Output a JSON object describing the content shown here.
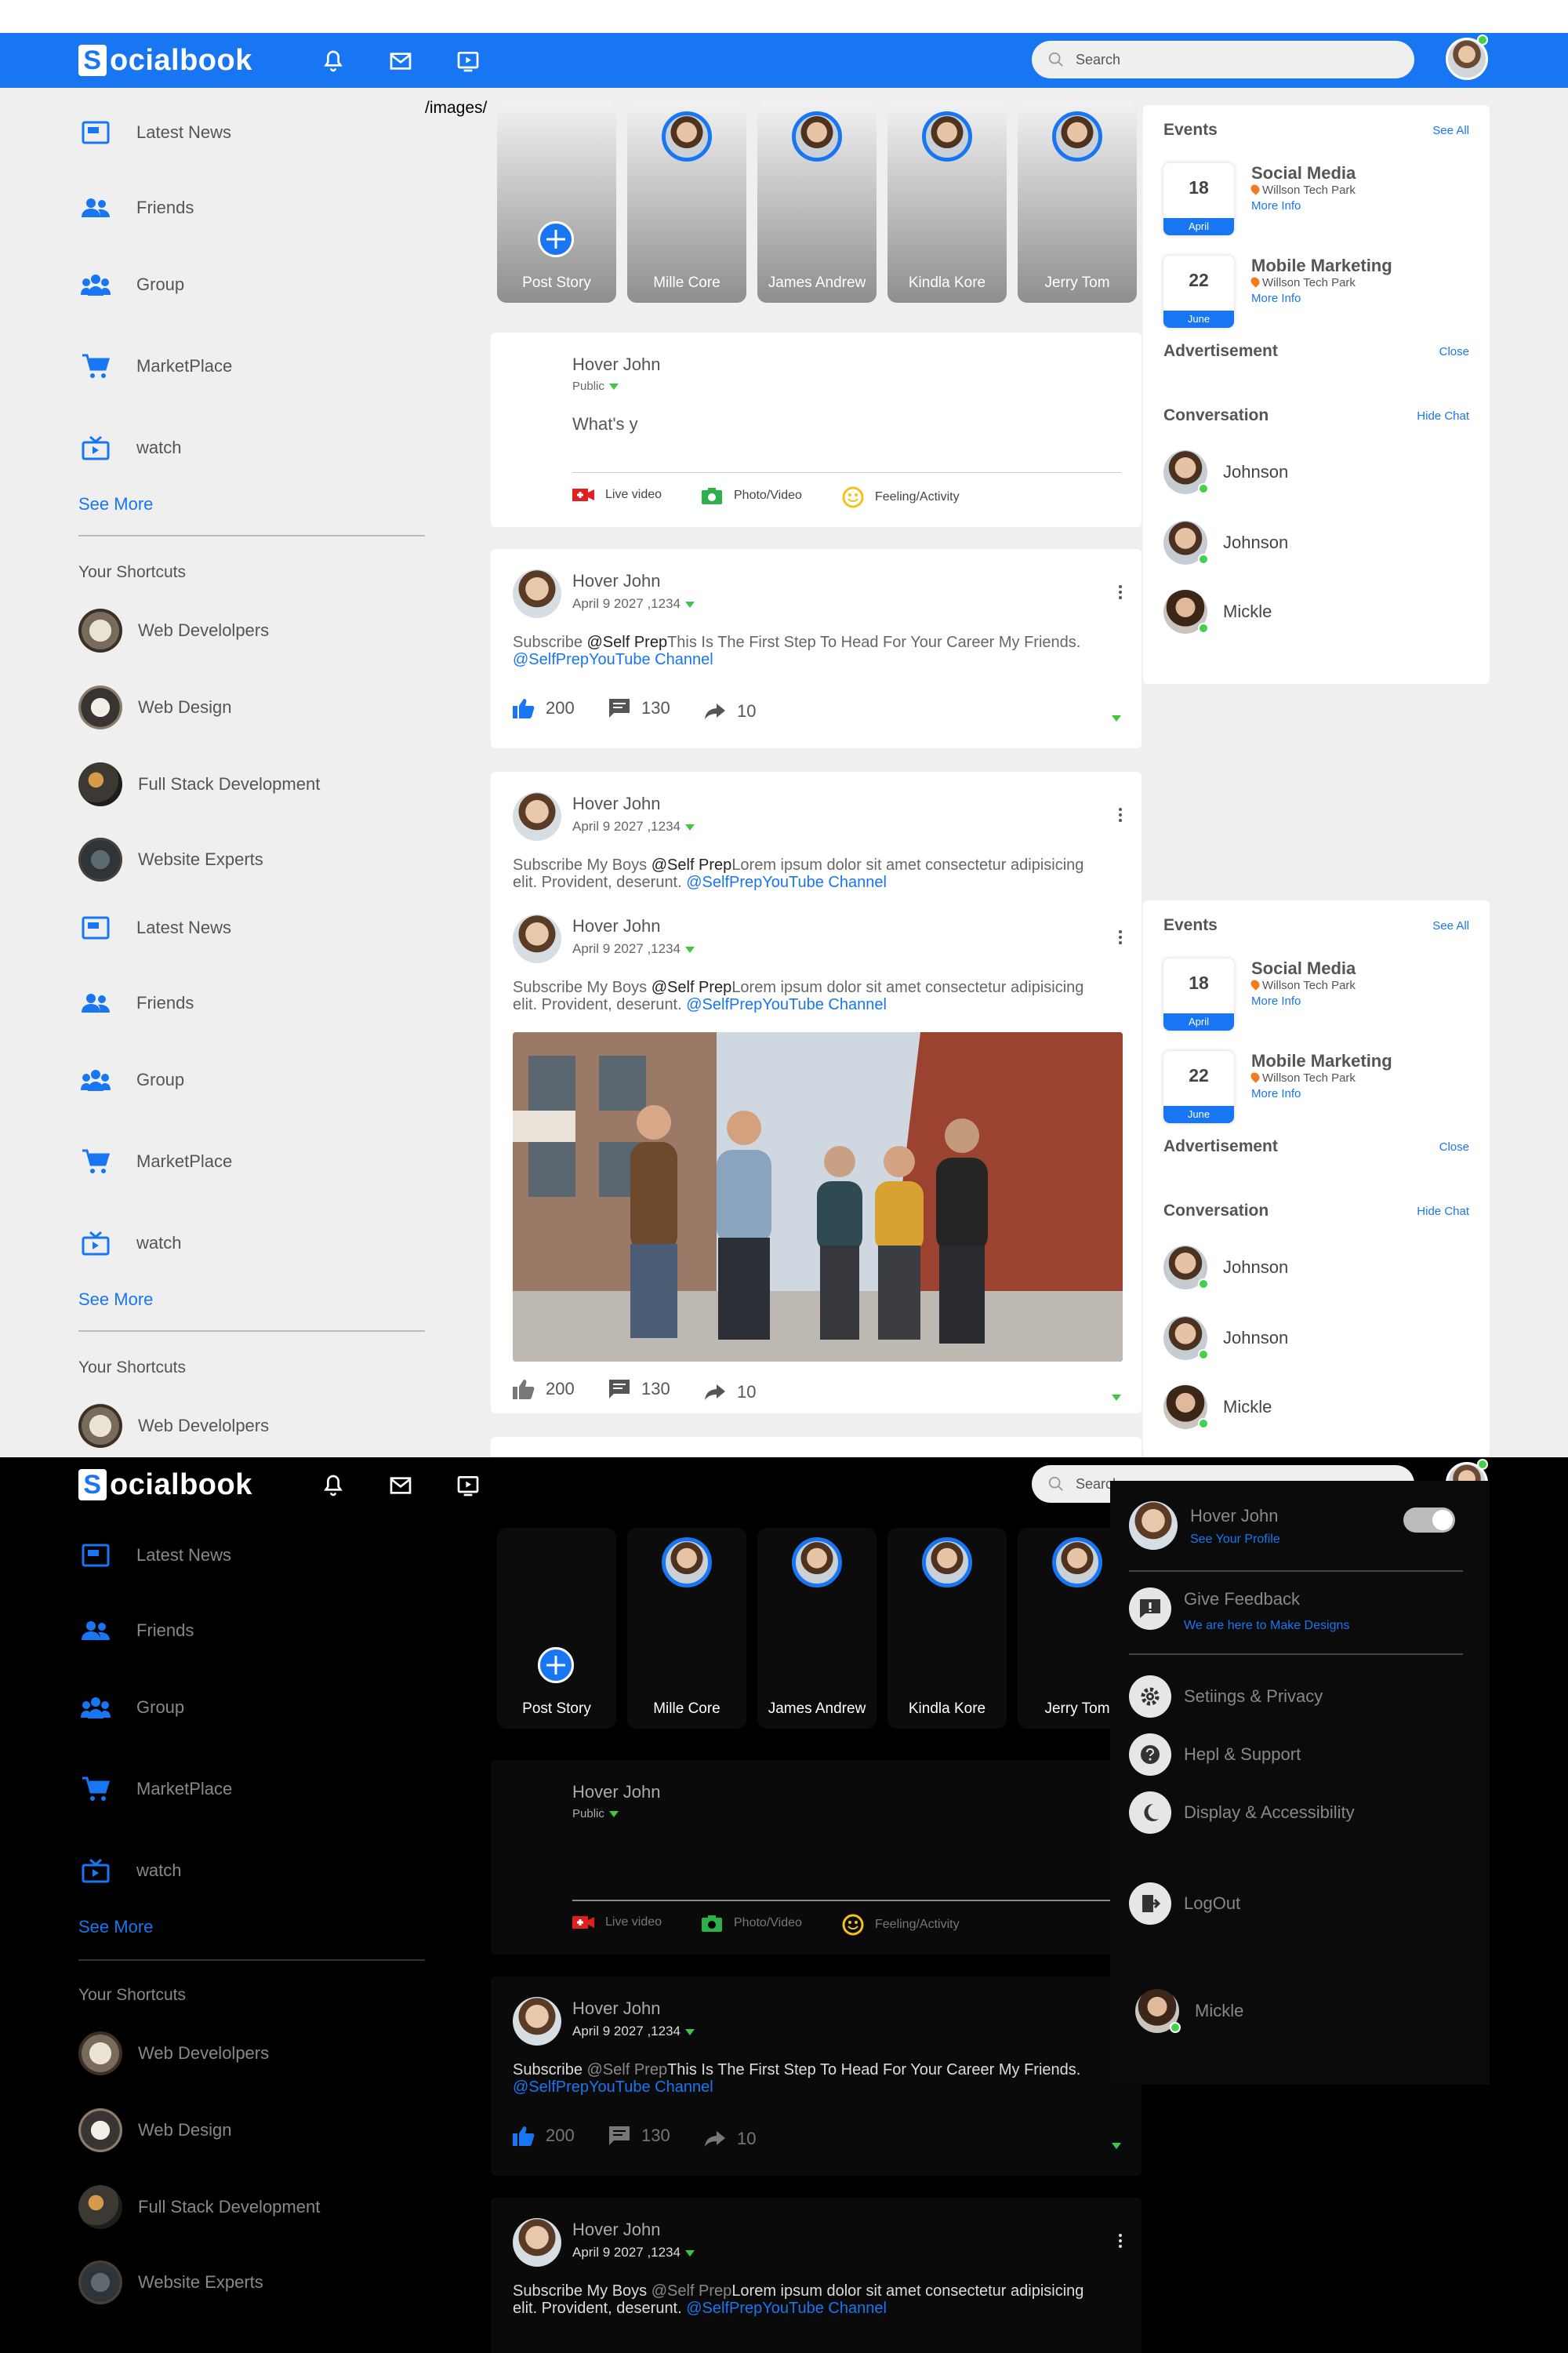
{
  "app": {
    "logo_s": "S",
    "logo_rest": "ocialbook",
    "images_path": "/images/"
  },
  "nav": {
    "search_placeholder": "Search"
  },
  "colors": {
    "brand": "#1876f2",
    "online": "#41d14a",
    "dark_bg": "#000000",
    "light_bg": "#efefef"
  },
  "left_menu": [
    {
      "label": "Latest News",
      "icon": "news-icon"
    },
    {
      "label": "Friends",
      "icon": "friends-icon"
    },
    {
      "label": "Group",
      "icon": "group-icon"
    },
    {
      "label": "MarketPlace",
      "icon": "cart-icon"
    },
    {
      "label": "watch",
      "icon": "tv-icon"
    }
  ],
  "see_more": "See More",
  "shortcuts_title": "Your Shortcuts",
  "shortcuts": [
    {
      "label": "Web Develolpers"
    },
    {
      "label": "Web Design"
    },
    {
      "label": "Full Stack Development"
    },
    {
      "label": "Website Experts"
    }
  ],
  "stories": [
    {
      "label": "Post Story"
    },
    {
      "label": "Mille Core"
    },
    {
      "label": "James Andrew"
    },
    {
      "label": "Kindla Kore"
    },
    {
      "label": "Jerry Tom"
    }
  ],
  "composer": {
    "name": "Hover John",
    "privacy": "Public",
    "input_value": "What's y",
    "actions": [
      "Live video",
      "Photo/Video",
      "Feeling/Activity"
    ]
  },
  "posts": [
    {
      "name": "Hover John",
      "date": "April 9 2027 ,1234",
      "prefix": "Subscribe ",
      "tag": "@Self Prep",
      "text": "This Is The First Step To Head For Your Career My Friends.",
      "link": "@SelfPrepYouTube Channel",
      "likes": "200",
      "comments": "130",
      "shares": "10"
    },
    {
      "name": "Hover John",
      "date": "April 9 2027 ,1234",
      "prefix": "Subscribe My Boys ",
      "tag": "@Self Prep",
      "text": "Lorem ipsum dolor sit amet consectetur adipisicing elit. Provident, deserunt. ",
      "link": "@SelfPrepYouTube Channel",
      "likes": "200",
      "comments": "130",
      "shares": "10"
    }
  ],
  "events": {
    "title": "Events",
    "see_all": "See All",
    "items": [
      {
        "day": "18",
        "month": "April",
        "title": "Social Media",
        "location": "Willson Tech Park",
        "more": "More Info"
      },
      {
        "day": "22",
        "month": "June",
        "title": "Mobile Marketing",
        "location": "Willson Tech Park",
        "more": "More Info"
      }
    ]
  },
  "advertisement": {
    "title": "Advertisement",
    "close": "Close"
  },
  "conversation": {
    "title": "Conversation",
    "hide": "Hide Chat",
    "people": [
      "Johnson",
      "Johnson",
      "Mickle"
    ]
  },
  "settings_menu": {
    "profile_name": "Hover John",
    "profile_sub": "See Your Profile",
    "feedback": "Give Feedback",
    "feedback_sub": "We are here to Make Designs",
    "items": [
      "Setiings & Privacy",
      "Hepl & Support",
      "Display & Accessibility"
    ],
    "logout": "LogOut",
    "chat_person": "Mickle"
  }
}
